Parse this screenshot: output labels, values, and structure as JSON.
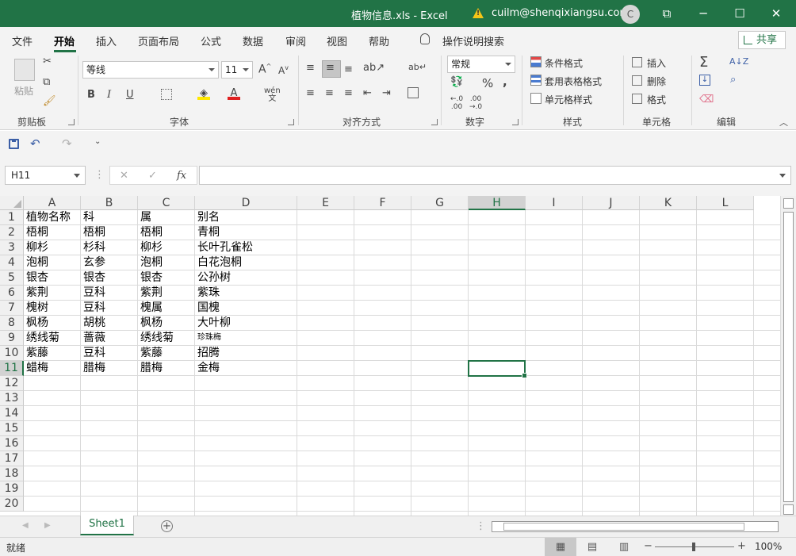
{
  "window": {
    "title": "植物信息.xls  -  Excel",
    "user": "cuilm@shenqixiangsu.com",
    "avatar_initial": "C",
    "controls": [
      "⧉",
      "─",
      "☐",
      "✕"
    ]
  },
  "tabs": [
    "文件",
    "开始",
    "插入",
    "页面布局",
    "公式",
    "数据",
    "审阅",
    "视图",
    "帮助"
  ],
  "active_tab": "开始",
  "tell_me": "操作说明搜索",
  "share_label": "共享",
  "ribbon": {
    "clipboard": {
      "paste": "粘贴",
      "label": "剪贴板"
    },
    "font": {
      "name": "等线",
      "size": "11",
      "label": "字体",
      "bold": "B",
      "italic": "I",
      "underline": "U",
      "phonetic": "wén"
    },
    "alignment": {
      "label": "对齐方式"
    },
    "number": {
      "format": "常规",
      "label": "数字",
      "percent": "%",
      "comma": ","
    },
    "styles": {
      "conditional": "条件格式",
      "table": "套用表格格式",
      "cell": "单元格样式",
      "label": "样式"
    },
    "cells": {
      "insert": "插入",
      "delete": "删除",
      "format": "格式",
      "label": "单元格"
    },
    "editing": {
      "label": "编辑",
      "sum": "Σ"
    }
  },
  "formula_bar": {
    "name_box": "H11",
    "formula": "",
    "fx": "fx",
    "cancel": "✕",
    "enter": "✓"
  },
  "columns": [
    "A",
    "B",
    "C",
    "D",
    "E",
    "F",
    "G",
    "H",
    "I",
    "J",
    "K",
    "L"
  ],
  "rows": [
    "1",
    "2",
    "3",
    "4",
    "5",
    "6",
    "7",
    "8",
    "9",
    "10",
    "11",
    "12",
    "13",
    "14",
    "15",
    "16",
    "17",
    "18",
    "19",
    "20"
  ],
  "selected_cell": "H11",
  "table": [
    [
      "植物名称",
      "科",
      "属",
      "别名"
    ],
    [
      "梧桐",
      "梧桐",
      "梧桐",
      "青桐"
    ],
    [
      "柳杉",
      "杉科",
      "柳杉",
      "长叶孔雀松"
    ],
    [
      "泡桐",
      "玄参",
      "泡桐",
      "白花泡桐"
    ],
    [
      "银杏",
      "银杏",
      "银杏",
      "公孙树"
    ],
    [
      "紫荆",
      "豆科",
      "紫荆",
      "紫珠"
    ],
    [
      "槐树",
      "豆科",
      "槐属",
      "国槐"
    ],
    [
      "枫杨",
      "胡桃",
      "枫杨",
      "大叶柳"
    ],
    [
      "绣线菊",
      "蔷薇",
      "绣线菊",
      "珍珠梅"
    ],
    [
      "紫藤",
      "豆科",
      "紫藤",
      "招腾"
    ],
    [
      "蜡梅",
      "腊梅",
      "腊梅",
      "金梅"
    ]
  ],
  "small_cell": {
    "row": 8,
    "col": 3
  },
  "sheet_tab": "Sheet1",
  "add_sheet": "+",
  "status": {
    "ready": "就绪",
    "zoom": "100%"
  },
  "colors": {
    "accent": "#217346"
  }
}
